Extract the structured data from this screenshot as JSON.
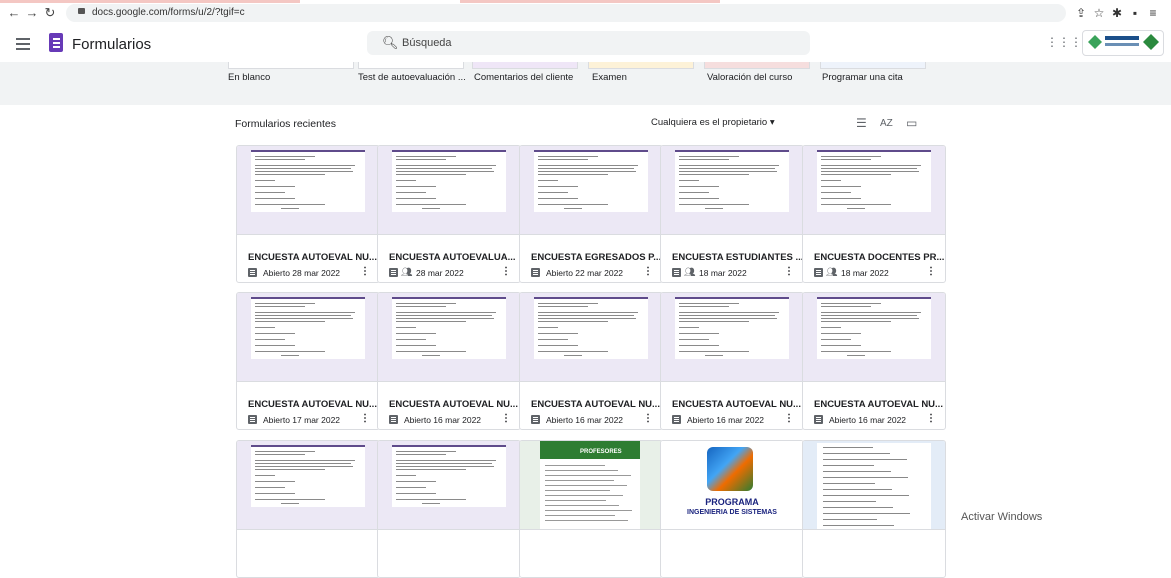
{
  "browser": {
    "url": "docs.google.com/forms/u/2/?tgif=c"
  },
  "app": {
    "name": "Formularios",
    "search_placeholder": "Búsqueda"
  },
  "templates": [
    {
      "label": "En blanco"
    },
    {
      "label": "Test de autoevaluación ..."
    },
    {
      "label": "Comentarios del cliente"
    },
    {
      "label": "Examen"
    },
    {
      "label": "Valoración del curso"
    },
    {
      "label": "Programar una cita"
    }
  ],
  "recent": {
    "title": "Formularios recientes",
    "owner_filter": "Cualquiera es el propietario"
  },
  "forms": [
    {
      "title": "ENCUESTA AUTOEVAL NU...",
      "date": "Abierto 28 mar 2022",
      "shared": false,
      "thumb": "doc"
    },
    {
      "title": "ENCUESTA AUTOEVALUA...",
      "date": "28 mar 2022",
      "shared": true,
      "thumb": "doc"
    },
    {
      "title": "ENCUESTA EGRESADOS P...",
      "date": "Abierto 22 mar 2022",
      "shared": false,
      "thumb": "doc"
    },
    {
      "title": "ENCUESTA ESTUDIANTES ...",
      "date": "18 mar 2022",
      "shared": true,
      "thumb": "doc"
    },
    {
      "title": "ENCUESTA DOCENTES PR...",
      "date": "18 mar 2022",
      "shared": true,
      "thumb": "doc"
    },
    {
      "title": "ENCUESTA AUTOEVAL NU...",
      "date": "Abierto 17 mar 2022",
      "shared": false,
      "thumb": "doc"
    },
    {
      "title": "ENCUESTA AUTOEVAL NU...",
      "date": "Abierto 16 mar 2022",
      "shared": false,
      "thumb": "doc"
    },
    {
      "title": "ENCUESTA AUTOEVAL NU...",
      "date": "Abierto 16 mar 2022",
      "shared": false,
      "thumb": "doc"
    },
    {
      "title": "ENCUESTA AUTOEVAL NU...",
      "date": "Abierto 16 mar 2022",
      "shared": false,
      "thumb": "doc"
    },
    {
      "title": "ENCUESTA AUTOEVAL NU...",
      "date": "Abierto 16 mar 2022",
      "shared": false,
      "thumb": "doc"
    },
    {
      "title": "",
      "date": "",
      "shared": false,
      "thumb": "doc"
    },
    {
      "title": "",
      "date": "",
      "shared": false,
      "thumb": "doc"
    },
    {
      "title": "",
      "date": "",
      "shared": false,
      "thumb": "green"
    },
    {
      "title": "",
      "date": "",
      "shared": false,
      "thumb": "sys"
    },
    {
      "title": "",
      "date": "",
      "shared": false,
      "thumb": "blue"
    }
  ],
  "thumb_text": {
    "program_line1": "PROGRAMA",
    "program_line2": "INGENIERIA DE SISTEMAS",
    "profesores": "PROFESORES"
  },
  "watermark": "Activar Windows"
}
